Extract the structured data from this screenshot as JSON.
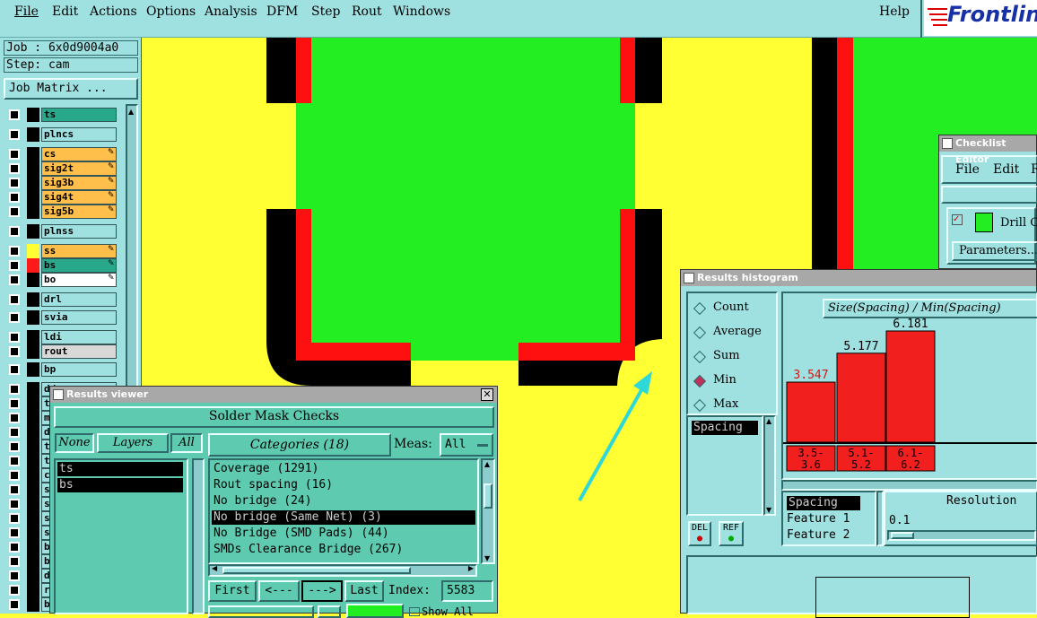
{
  "menubar": {
    "items": [
      "File",
      "Edit",
      "Actions",
      "Options",
      "Analysis",
      "DFM",
      "Step",
      "Rout",
      "Windows"
    ],
    "help": "Help",
    "logo": "Frontline"
  },
  "job": {
    "job_label": "Job : 6x0d9004a0",
    "step_label": "Step: cam",
    "matrix_button": "Job Matrix ..."
  },
  "layers": [
    {
      "name": "ts",
      "bg": "#2aa88c",
      "sq": "#000000"
    },
    {
      "name": "plncs",
      "bg": "#9fe0e0",
      "sq": "#000000"
    },
    {
      "name": "cs",
      "bg": "#ffbf4a",
      "sq": "#000000",
      "edit": true
    },
    {
      "name": "sig2t",
      "bg": "#ffbf4a",
      "sq": "#000000",
      "edit": true
    },
    {
      "name": "sig3b",
      "bg": "#ffbf4a",
      "sq": "#000000",
      "edit": true
    },
    {
      "name": "sig4t",
      "bg": "#ffbf4a",
      "sq": "#000000",
      "edit": true
    },
    {
      "name": "sig5b",
      "bg": "#ffbf4a",
      "sq": "#000000",
      "edit": true
    },
    {
      "name": "plnss",
      "bg": "#9fe0e0",
      "sq": "#000000"
    },
    {
      "name": "ss",
      "bg": "#ffbf4a",
      "sq": "#ffff33",
      "edit": true
    },
    {
      "name": "bs",
      "bg": "#2aa88c",
      "sq": "#ff1a1a",
      "edit": true
    },
    {
      "name": "bo",
      "bg": "#ffffff",
      "sq": "#000000",
      "edit": true
    },
    {
      "name": "drl",
      "bg": "#9fe0e0",
      "sq": "#000000"
    },
    {
      "name": "svia",
      "bg": "#9fe0e0",
      "sq": "#000000"
    },
    {
      "name": "ldi",
      "bg": "#9fe0e0",
      "sq": "#000000"
    },
    {
      "name": "rout",
      "bg": "#d8d8d8",
      "sq": "#000000"
    },
    {
      "name": "bp",
      "bg": "#9fe0e0",
      "sq": "#000000"
    }
  ],
  "layers_partial": [
    "dd",
    "tj",
    "m",
    "d",
    "te",
    "ts",
    "cs",
    "s",
    "s",
    "s",
    "s",
    "bs",
    "be",
    "dı",
    "ro",
    "b"
  ],
  "results_viewer": {
    "title": "Results viewer",
    "header": "Solder Mask Checks",
    "none_btn": "None",
    "layers_label": "Layers",
    "all_btn": "All",
    "layer_list": [
      "ts",
      "bs"
    ],
    "categories_label": "Categories (18)",
    "meas_label": "Meas:",
    "meas_value": "All",
    "categories": [
      "Coverage (1291)",
      "Rout spacing (16)",
      "No bridge (24)",
      "No bridge (Same Net) (3)",
      "No Bridge (SMD Pads) (44)",
      "SMDs Clearance Bridge (267)"
    ],
    "selected_category_index": 3,
    "first_btn": "First",
    "prev_btn": "<---",
    "next_btn": "--->",
    "last_btn": "Last",
    "index_label": "Index:",
    "index_value": "5583",
    "show_all": "Show All"
  },
  "histogram": {
    "title": "Results histogram",
    "modes": [
      "Count",
      "Average",
      "Sum",
      "Min",
      "Max"
    ],
    "selected_mode": "Min",
    "measure_list": [
      "Spacing"
    ],
    "chart_title": "Size(Spacing) / Min(Spacing)",
    "bars": [
      {
        "value": "3.547",
        "range": [
          "3.5-",
          "3.6"
        ],
        "frac": 0.54
      },
      {
        "value": "5.177",
        "range": [
          "5.1-",
          "5.2"
        ],
        "frac": 0.8
      },
      {
        "value": "6.181",
        "range": [
          "6.1-",
          "6.2"
        ],
        "frac": 1.0
      }
    ],
    "sort_list": [
      "Spacing",
      "Feature 1",
      "Feature 2"
    ],
    "resolution_label": "Resolution",
    "resolution_value": "0.1",
    "del_btn": "DEL",
    "ref_btn": "REF"
  },
  "checklist": {
    "title": "Checklist Editor",
    "menu": [
      "File",
      "Edit",
      "R"
    ],
    "item": "Drill C",
    "params_btn": "Parameters..."
  },
  "colors": {
    "board": "#ffff33",
    "copper": "#22ee22",
    "outline": "#000000",
    "mask": "#ff1010",
    "panel": "#9fe0e0",
    "accent": "#2aa88c",
    "arrow": "#2ed8d8"
  }
}
